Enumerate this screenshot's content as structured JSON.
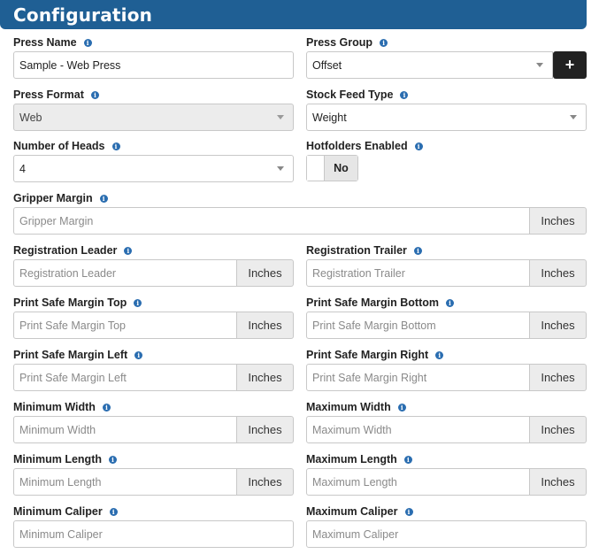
{
  "header": {
    "title": "Configuration"
  },
  "fields": {
    "press_name": {
      "label": "Press Name",
      "value": "Sample - Web Press"
    },
    "press_group": {
      "label": "Press Group",
      "value": "Offset",
      "add_label": "+"
    },
    "press_format": {
      "label": "Press Format",
      "value": "Web"
    },
    "stock_feed_type": {
      "label": "Stock Feed Type",
      "value": "Weight"
    },
    "number_of_heads": {
      "label": "Number of Heads",
      "value": "4"
    },
    "hotfolders_enabled": {
      "label": "Hotfolders Enabled",
      "value": "No"
    },
    "gripper_margin": {
      "label": "Gripper Margin",
      "placeholder": "Gripper Margin",
      "unit": "Inches"
    },
    "registration_leader": {
      "label": "Registration Leader",
      "placeholder": "Registration Leader",
      "unit": "Inches"
    },
    "registration_trailer": {
      "label": "Registration Trailer",
      "placeholder": "Registration Trailer",
      "unit": "Inches"
    },
    "print_safe_margin_top": {
      "label": "Print Safe Margin Top",
      "placeholder": "Print Safe Margin Top",
      "unit": "Inches"
    },
    "print_safe_margin_bottom": {
      "label": "Print Safe Margin Bottom",
      "placeholder": "Print Safe Margin Bottom",
      "unit": "Inches"
    },
    "print_safe_margin_left": {
      "label": "Print Safe Margin Left",
      "placeholder": "Print Safe Margin Left",
      "unit": "Inches"
    },
    "print_safe_margin_right": {
      "label": "Print Safe Margin Right",
      "placeholder": "Print Safe Margin Right",
      "unit": "Inches"
    },
    "minimum_width": {
      "label": "Minimum Width",
      "placeholder": "Minimum Width",
      "unit": "Inches"
    },
    "maximum_width": {
      "label": "Maximum Width",
      "placeholder": "Maximum Width",
      "unit": "Inches"
    },
    "minimum_length": {
      "label": "Minimum Length",
      "placeholder": "Minimum Length",
      "unit": "Inches"
    },
    "maximum_length": {
      "label": "Maximum Length",
      "placeholder": "Maximum Length",
      "unit": "Inches"
    },
    "minimum_caliper": {
      "label": "Minimum Caliper",
      "placeholder": "Minimum Caliper"
    },
    "maximum_caliper": {
      "label": "Maximum Caliper",
      "placeholder": "Maximum Caliper"
    }
  },
  "icons": {
    "info": "info-icon",
    "caret": "chevron-down-icon"
  },
  "colors": {
    "header_bg": "#1f5f94",
    "info_icon": "#2a6db0",
    "addon_bg": "#ececec",
    "add_button": "#222222"
  }
}
